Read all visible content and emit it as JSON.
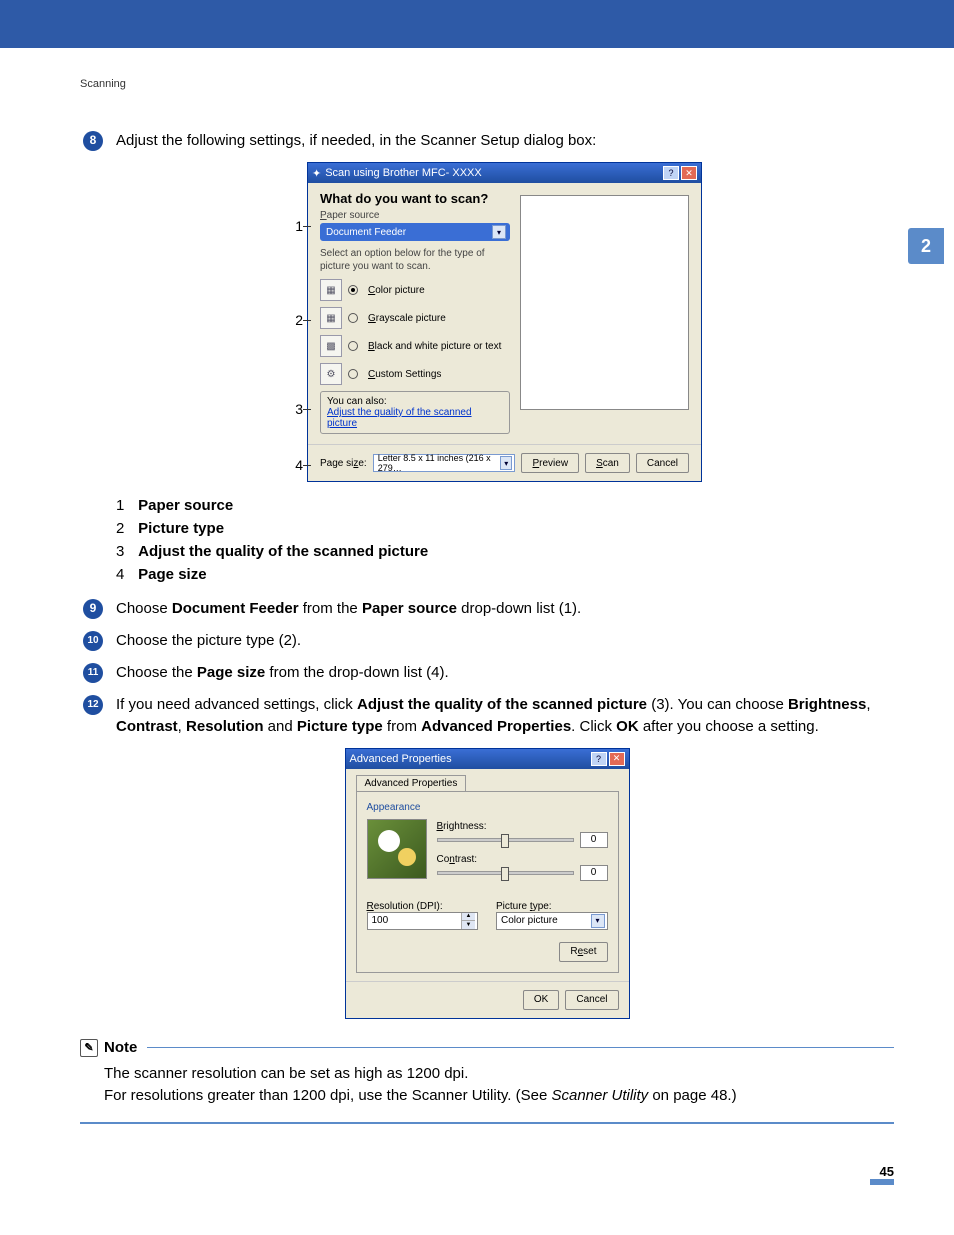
{
  "header": {
    "section": "Scanning"
  },
  "chapter": "2",
  "steps": {
    "s8_num": "8",
    "s8": "Adjust the following settings, if needed, in the Scanner Setup dialog box:",
    "s9_num": "9",
    "s9_a": "Choose ",
    "s9_b": "Document Feeder",
    "s9_c": " from the ",
    "s9_d": "Paper source",
    "s9_e": " drop-down list (1).",
    "s10_num": "10",
    "s10": "Choose the picture type (2).",
    "s11_num": "11",
    "s11_a": "Choose the ",
    "s11_b": "Page size",
    "s11_c": " from the drop-down list (4).",
    "s12_num": "12",
    "s12_a": "If you need advanced settings, click ",
    "s12_b": "Adjust the quality of the scanned picture",
    "s12_c": " (3). You can choose ",
    "s12_d": "Brightness",
    "s12_comma1": ", ",
    "s12_e": "Contrast",
    "s12_comma2": ", ",
    "s12_f": "Resolution",
    "s12_and": " and ",
    "s12_g": "Picture type",
    "s12_from": " from ",
    "s12_h": "Advanced Properties",
    "s12_i": ". Click ",
    "s12_j": "OK",
    "s12_k": " after you choose a setting."
  },
  "callouts": {
    "c1": "1",
    "c2": "2",
    "c3": "3",
    "c4": "4"
  },
  "scan": {
    "title": "Scan using Brother MFC- XXXX",
    "help": "?",
    "close": "✕",
    "heading": "What do you want to scan?",
    "paper_source_label": "Paper source",
    "paper_source_value": "Document Feeder",
    "select_hint": "Select an option below for the type of picture you want to scan.",
    "opt_color": "Color picture",
    "opt_gray": "Grayscale picture",
    "opt_bw": "Black and white picture or text",
    "opt_custom": "Custom Settings",
    "you_can_also": "You can also:",
    "adjust_link": "Adjust the quality of the scanned picture",
    "page_size_label": "Page size:",
    "page_size_value": "Letter 8.5 x 11 inches (216 x 279…",
    "btn_preview": "Preview",
    "btn_scan": "Scan",
    "btn_cancel": "Cancel"
  },
  "numlist": {
    "n1": "1",
    "l1": "Paper source",
    "n2": "2",
    "l2": "Picture type",
    "n3": "3",
    "l3": "Adjust the quality of the scanned picture",
    "n4": "4",
    "l4": "Page size"
  },
  "adv": {
    "title": "Advanced Properties",
    "help": "?",
    "close": "✕",
    "tab": "Advanced Properties",
    "appearance": "Appearance",
    "brightness": "Brightness:",
    "brightness_val": "0",
    "contrast": "Contrast:",
    "contrast_val": "0",
    "resolution_label": "Resolution (DPI):",
    "resolution_val": "100",
    "ptype_label": "Picture type:",
    "ptype_val": "Color picture",
    "reset": "Reset",
    "ok": "OK",
    "cancel": "Cancel"
  },
  "note": {
    "label": "Note",
    "line1": "The scanner resolution can be set as high as 1200 dpi.",
    "line2a": "For resolutions greater than 1200 dpi, use the Scanner Utility. (See ",
    "line2b": "Scanner Utility",
    "line2c": " on page 48.)"
  },
  "page_number": "45"
}
